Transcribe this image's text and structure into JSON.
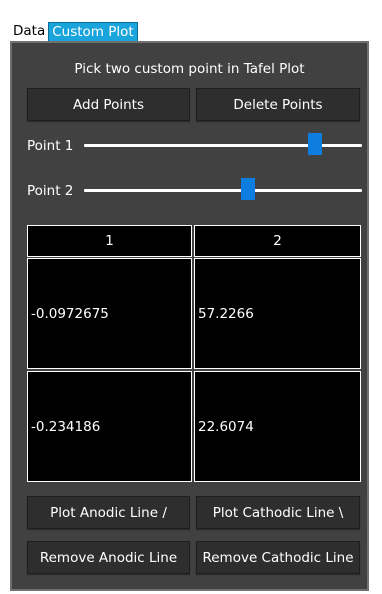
{
  "tabs": [
    {
      "label": "Data",
      "active": false
    },
    {
      "label": "Custom Plot",
      "active": true
    }
  ],
  "panel": {
    "instruction": "Pick two custom point in Tafel Plot",
    "add_points_label": "Add Points",
    "delete_points_label": "Delete Points",
    "sliders": [
      {
        "label": "Point 1",
        "position": 0.83
      },
      {
        "label": "Point 2",
        "position": 0.59
      }
    ],
    "table": {
      "columns": [
        "1",
        "2"
      ],
      "rows": [
        [
          "-0.0972675",
          "57.2266"
        ],
        [
          "-0.234186",
          "22.6074"
        ]
      ]
    },
    "plot_anodic_label": "Plot Anodic Line /",
    "plot_cathodic_label": "Plot Cathodic Line \\",
    "remove_anodic_label": "Remove Anodic Line",
    "remove_cathodic_label": "Remove Cathodic Line"
  },
  "colors": {
    "accent": "#19a4dc",
    "slider_thumb": "#0e7de0",
    "panel_bg": "#414141",
    "button_bg": "#2e2e2e"
  }
}
